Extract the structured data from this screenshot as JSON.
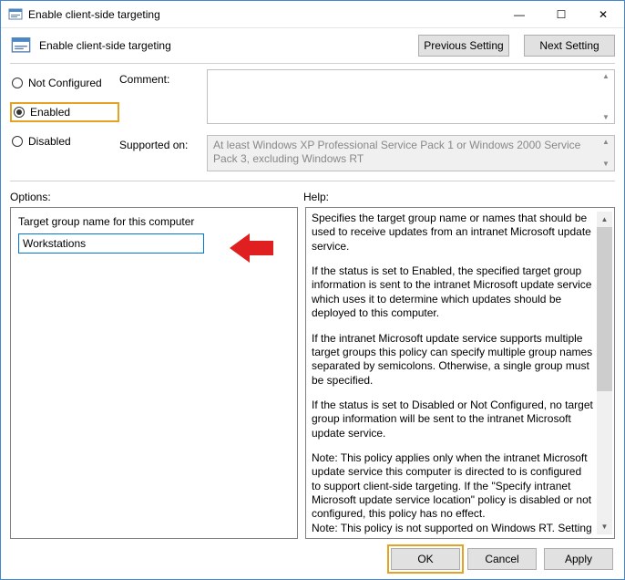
{
  "window": {
    "title": "Enable client-side targeting"
  },
  "header": {
    "title": "Enable client-side targeting",
    "nav": {
      "prev": "Previous Setting",
      "next": "Next Setting"
    }
  },
  "state": {
    "not_configured": "Not Configured",
    "enabled": "Enabled",
    "disabled": "Disabled"
  },
  "fields": {
    "comment_label": "Comment:",
    "comment_value": "",
    "supported_label": "Supported on:",
    "supported_value": "At least Windows XP Professional Service Pack 1 or Windows 2000 Service Pack 3, excluding Windows RT"
  },
  "sections": {
    "options_label": "Options:",
    "help_label": "Help:"
  },
  "options": {
    "target_group_label": "Target group name for this computer",
    "target_group_value": "Workstations"
  },
  "help": {
    "p1": "Specifies the target group name or names that should be used to receive updates from an intranet Microsoft update service.",
    "p2": "If the status is set to Enabled, the specified target group information is sent to the intranet Microsoft update service which uses it to determine which updates should be deployed to this computer.",
    "p3": "If the intranet Microsoft update service supports multiple target groups this policy can specify multiple group names separated by semicolons. Otherwise, a single group must be specified.",
    "p4": "If the status is set to Disabled or Not Configured, no target group information will be sent to the intranet Microsoft update service.",
    "p5": "Note: This policy applies only when the intranet Microsoft update service this computer is directed to is configured to support client-side targeting. If the \"Specify intranet Microsoft update service location\" policy is disabled or not configured, this policy has no effect.",
    "p6": "Note: This policy is not supported on Windows RT. Setting this"
  },
  "footer": {
    "ok": "OK",
    "cancel": "Cancel",
    "apply": "Apply"
  }
}
